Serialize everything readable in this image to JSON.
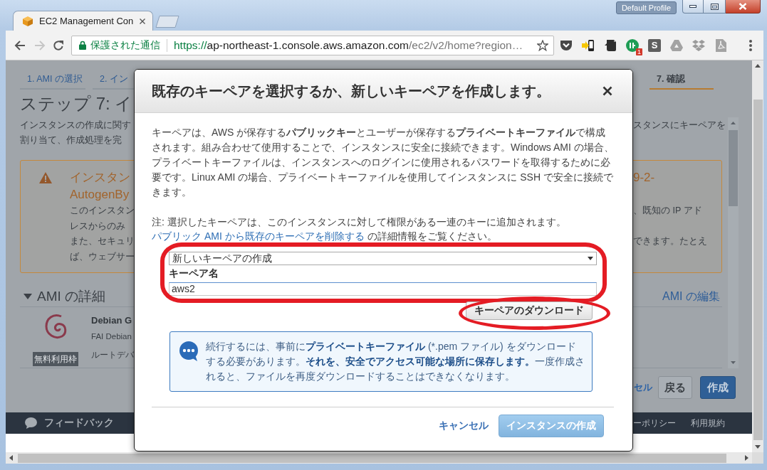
{
  "browser": {
    "profile": "Default Profile",
    "tabs": [
      {
        "title": "EC2 Management Con",
        "selected": true
      }
    ],
    "address": {
      "security": "保護された通信",
      "scheme": "https://",
      "host": "ap-northeast-1.console.aws.amazon.com",
      "path": "/ec2/v2/home?region…"
    },
    "extension_badge": "1",
    "tile_letter": "S"
  },
  "page": {
    "steps": [
      {
        "label": "1. AMI の選択",
        "selected": false
      },
      {
        "label": "2. イン",
        "selected": false
      },
      {
        "label": "7. 確認",
        "selected": true
      }
    ],
    "heading": "ステップ 7: イ",
    "description": [
      {
        "left": "インスタンスの作成に関す",
        "right": "スタンスにキーペアを"
      },
      {
        "left": "割り当て、作成処理を完"
      }
    ],
    "warning": {
      "title": {
        "left": "インスタン",
        "right": "9-2-"
      },
      "title_line_2": "AutogenBy",
      "lines": [
        {
          "left": "このインスタン",
          "right": "、既知の IP アド"
        },
        {
          "left": "レスからのみ"
        },
        {
          "left": "また、セキュリ",
          "right": "できます。たとえ"
        },
        {
          "left": "ば、ウェブサー"
        }
      ]
    },
    "ami": {
      "title": "AMI の詳細",
      "expanded": true,
      "edit_link": "AMI の編集",
      "name": "Debian G",
      "description": "FAI Debian",
      "badge": "無料利用枠",
      "root_device": "ルートデバ"
    },
    "buttons": [
      {
        "kind": "link",
        "label": "セル"
      },
      {
        "kind": "secondary",
        "label": "戻る"
      },
      {
        "kind": "primary",
        "label": "作成"
      }
    ],
    "footer": {
      "feedback": "フィードバック",
      "links": [
        "ーポリシー",
        "利用規約"
      ]
    }
  },
  "modal": {
    "title": "既存のキーペアを選択するか、新しいキーペアを作成します。",
    "intro": "キーペアは、AWS が保存する**パブリックキー**とユーザーが保存する**プライベートキーファイル**で構成されます。組み合わせて使用することで、インスタンスに安全に接続できます。Windows AMI の場合、プライベートキーファイルは、インスタンスへのログインに使用されるパスワードを取得するために必要です。Linux AMI の場合、プライベートキーファイルを使用してインスタンスに SSH で安全に接続できます。",
    "note": {
      "text": "注: 選択したキーペアは、このインスタンスに対して権限がある一連のキーに追加されます。",
      "link": "パブリック AMI から既存のキーペアを削除する",
      "after": "の詳細情報をご覧ください。"
    },
    "key_pair": {
      "action": "新しいキーペアの作成",
      "name_label": "キーペア名",
      "name_value": "aws2",
      "highlighted": true
    },
    "download": {
      "label": "キーペアのダウンロード",
      "highlighted": true
    },
    "info": "続行するには、事前に**プライベートキーファイル** (*.pem ファイル) をダウンロードする必要があります。**それを、安全でアクセス可能な場所に保存します。**一度作成されると、ファイルを再度ダウンロードすることはできなくなります。",
    "cancel": "キャンセル",
    "submit": {
      "label": "インスタンスの作成",
      "disabled": true
    }
  }
}
